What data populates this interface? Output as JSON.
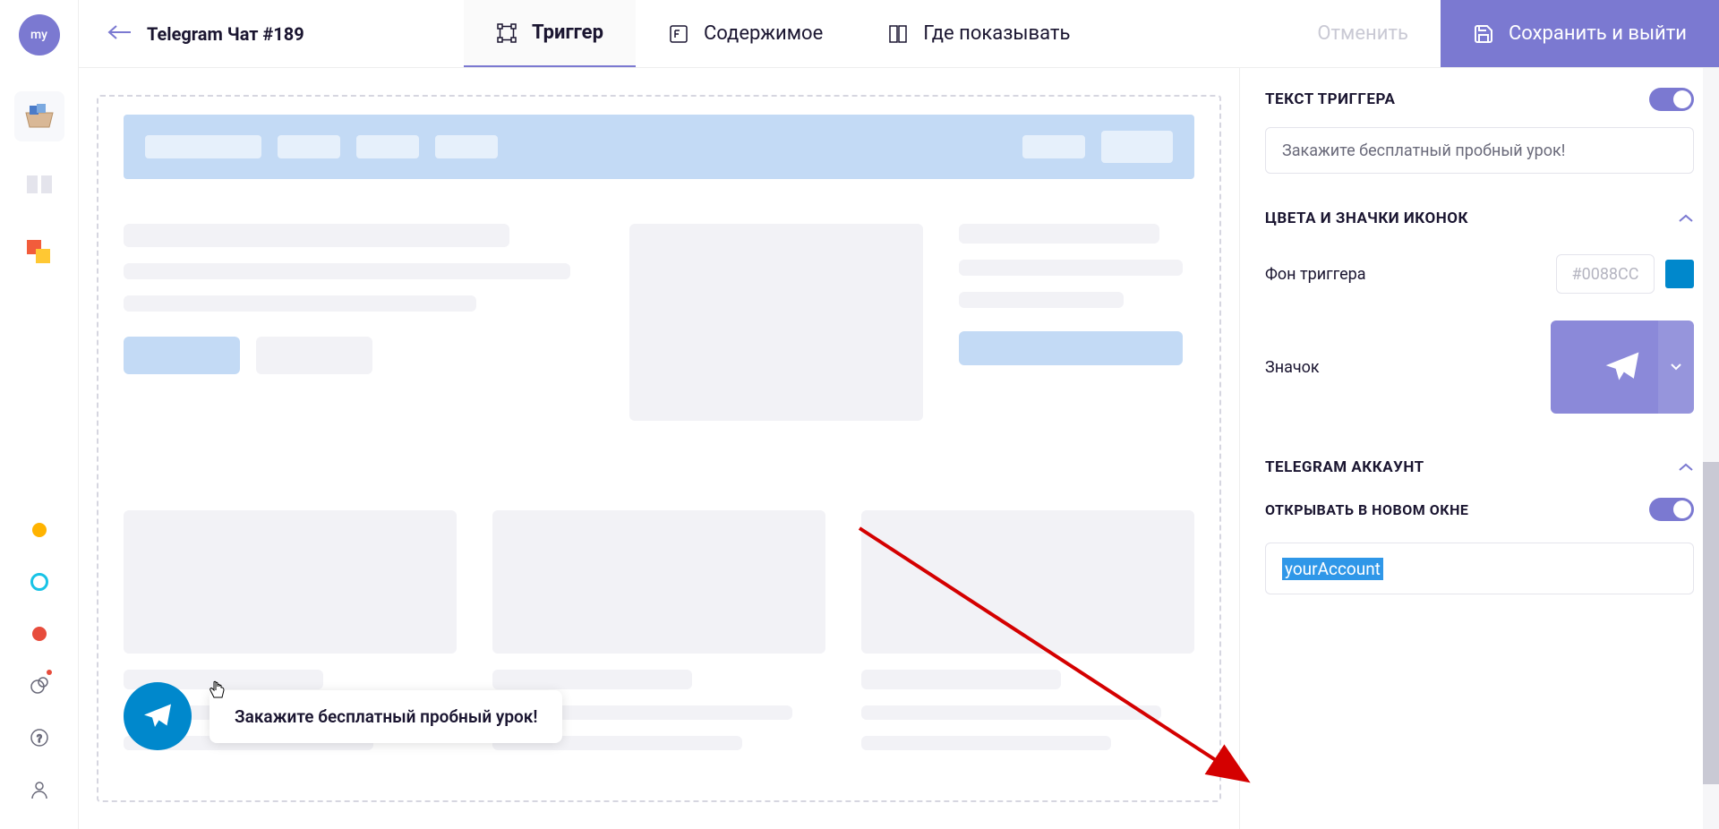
{
  "rail": {
    "avatar": "my"
  },
  "header": {
    "title": "Telegram Чат #189",
    "tabs": [
      {
        "label": "Триггер",
        "active": true
      },
      {
        "label": "Содержимое",
        "active": false
      },
      {
        "label": "Где показывать",
        "active": false
      }
    ],
    "cancel": "Отменить",
    "save": "Сохранить и выйти"
  },
  "widget": {
    "bubble": "Закажите бесплатный пробный урок!"
  },
  "panel": {
    "trigger_text_title": "ТЕКСТ ТРИГГЕРА",
    "trigger_text_value": "Закажите бесплатный пробный урок!",
    "colors_title": "ЦВЕТА И ЗНАЧКИ ИКОНОК",
    "bg_label": "Фон триггера",
    "bg_value": "#0088CC",
    "icon_label": "Значок",
    "account_title": "TELEGRAM АККАУНТ",
    "new_window_label": "ОТКРЫВАТЬ В НОВОМ ОКНЕ",
    "account_value": "yourAccount"
  }
}
